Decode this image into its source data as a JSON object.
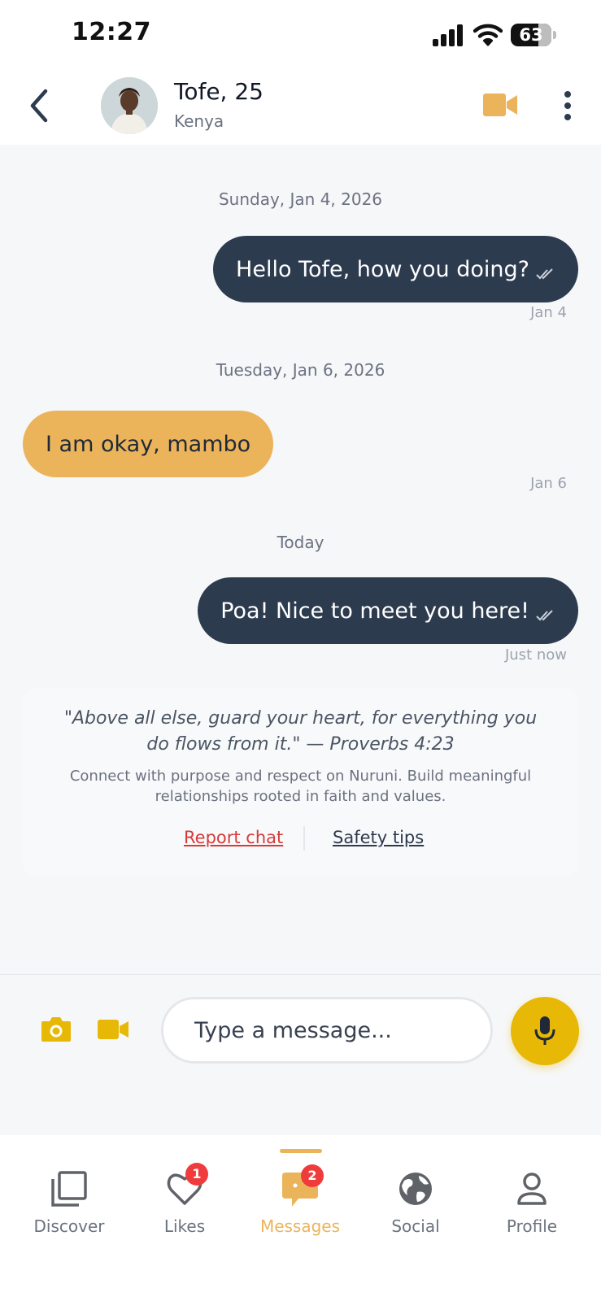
{
  "status_bar": {
    "time": "12:27",
    "battery": "63"
  },
  "header": {
    "name": "Tofe, 25",
    "country": "Kenya"
  },
  "chat": {
    "messages": [
      {
        "date_label": "Sunday, Jan 4, 2026",
        "direction": "outgoing",
        "text": "Hello Tofe, how you doing?",
        "time": "Jan 4"
      },
      {
        "date_label": "Tuesday, Jan 6, 2026",
        "direction": "incoming",
        "text": "I am okay, mambo",
        "time": "Jan 6"
      },
      {
        "date_label": "Today",
        "direction": "outgoing",
        "text": "Poa! Nice to meet you here!",
        "time": "Just now"
      }
    ],
    "info_card": {
      "quote": "\"Above all else, guard your heart, for everything you do flows from it.\" — Proverbs 4:23",
      "description": "Connect with purpose and respect on Nuruni. Build meaningful relationships rooted in faith and values.",
      "report_label": "Report chat",
      "safety_label": "Safety tips"
    }
  },
  "composer": {
    "placeholder": "Type a message..."
  },
  "tabs": [
    {
      "label": "Discover",
      "icon": "stack-icon"
    },
    {
      "label": "Likes",
      "icon": "heart-icon",
      "badge": "1"
    },
    {
      "label": "Messages",
      "icon": "chat-icon",
      "badge": "2",
      "active": true
    },
    {
      "label": "Social",
      "icon": "globe-icon"
    },
    {
      "label": "Profile",
      "icon": "person-icon"
    }
  ],
  "colors": {
    "accent": "#ebb45b",
    "outgoing_bubble": "#2d3b4f",
    "mic_button": "#e8b807",
    "badge": "#ef3b3b",
    "report_link": "#d63b3b"
  }
}
